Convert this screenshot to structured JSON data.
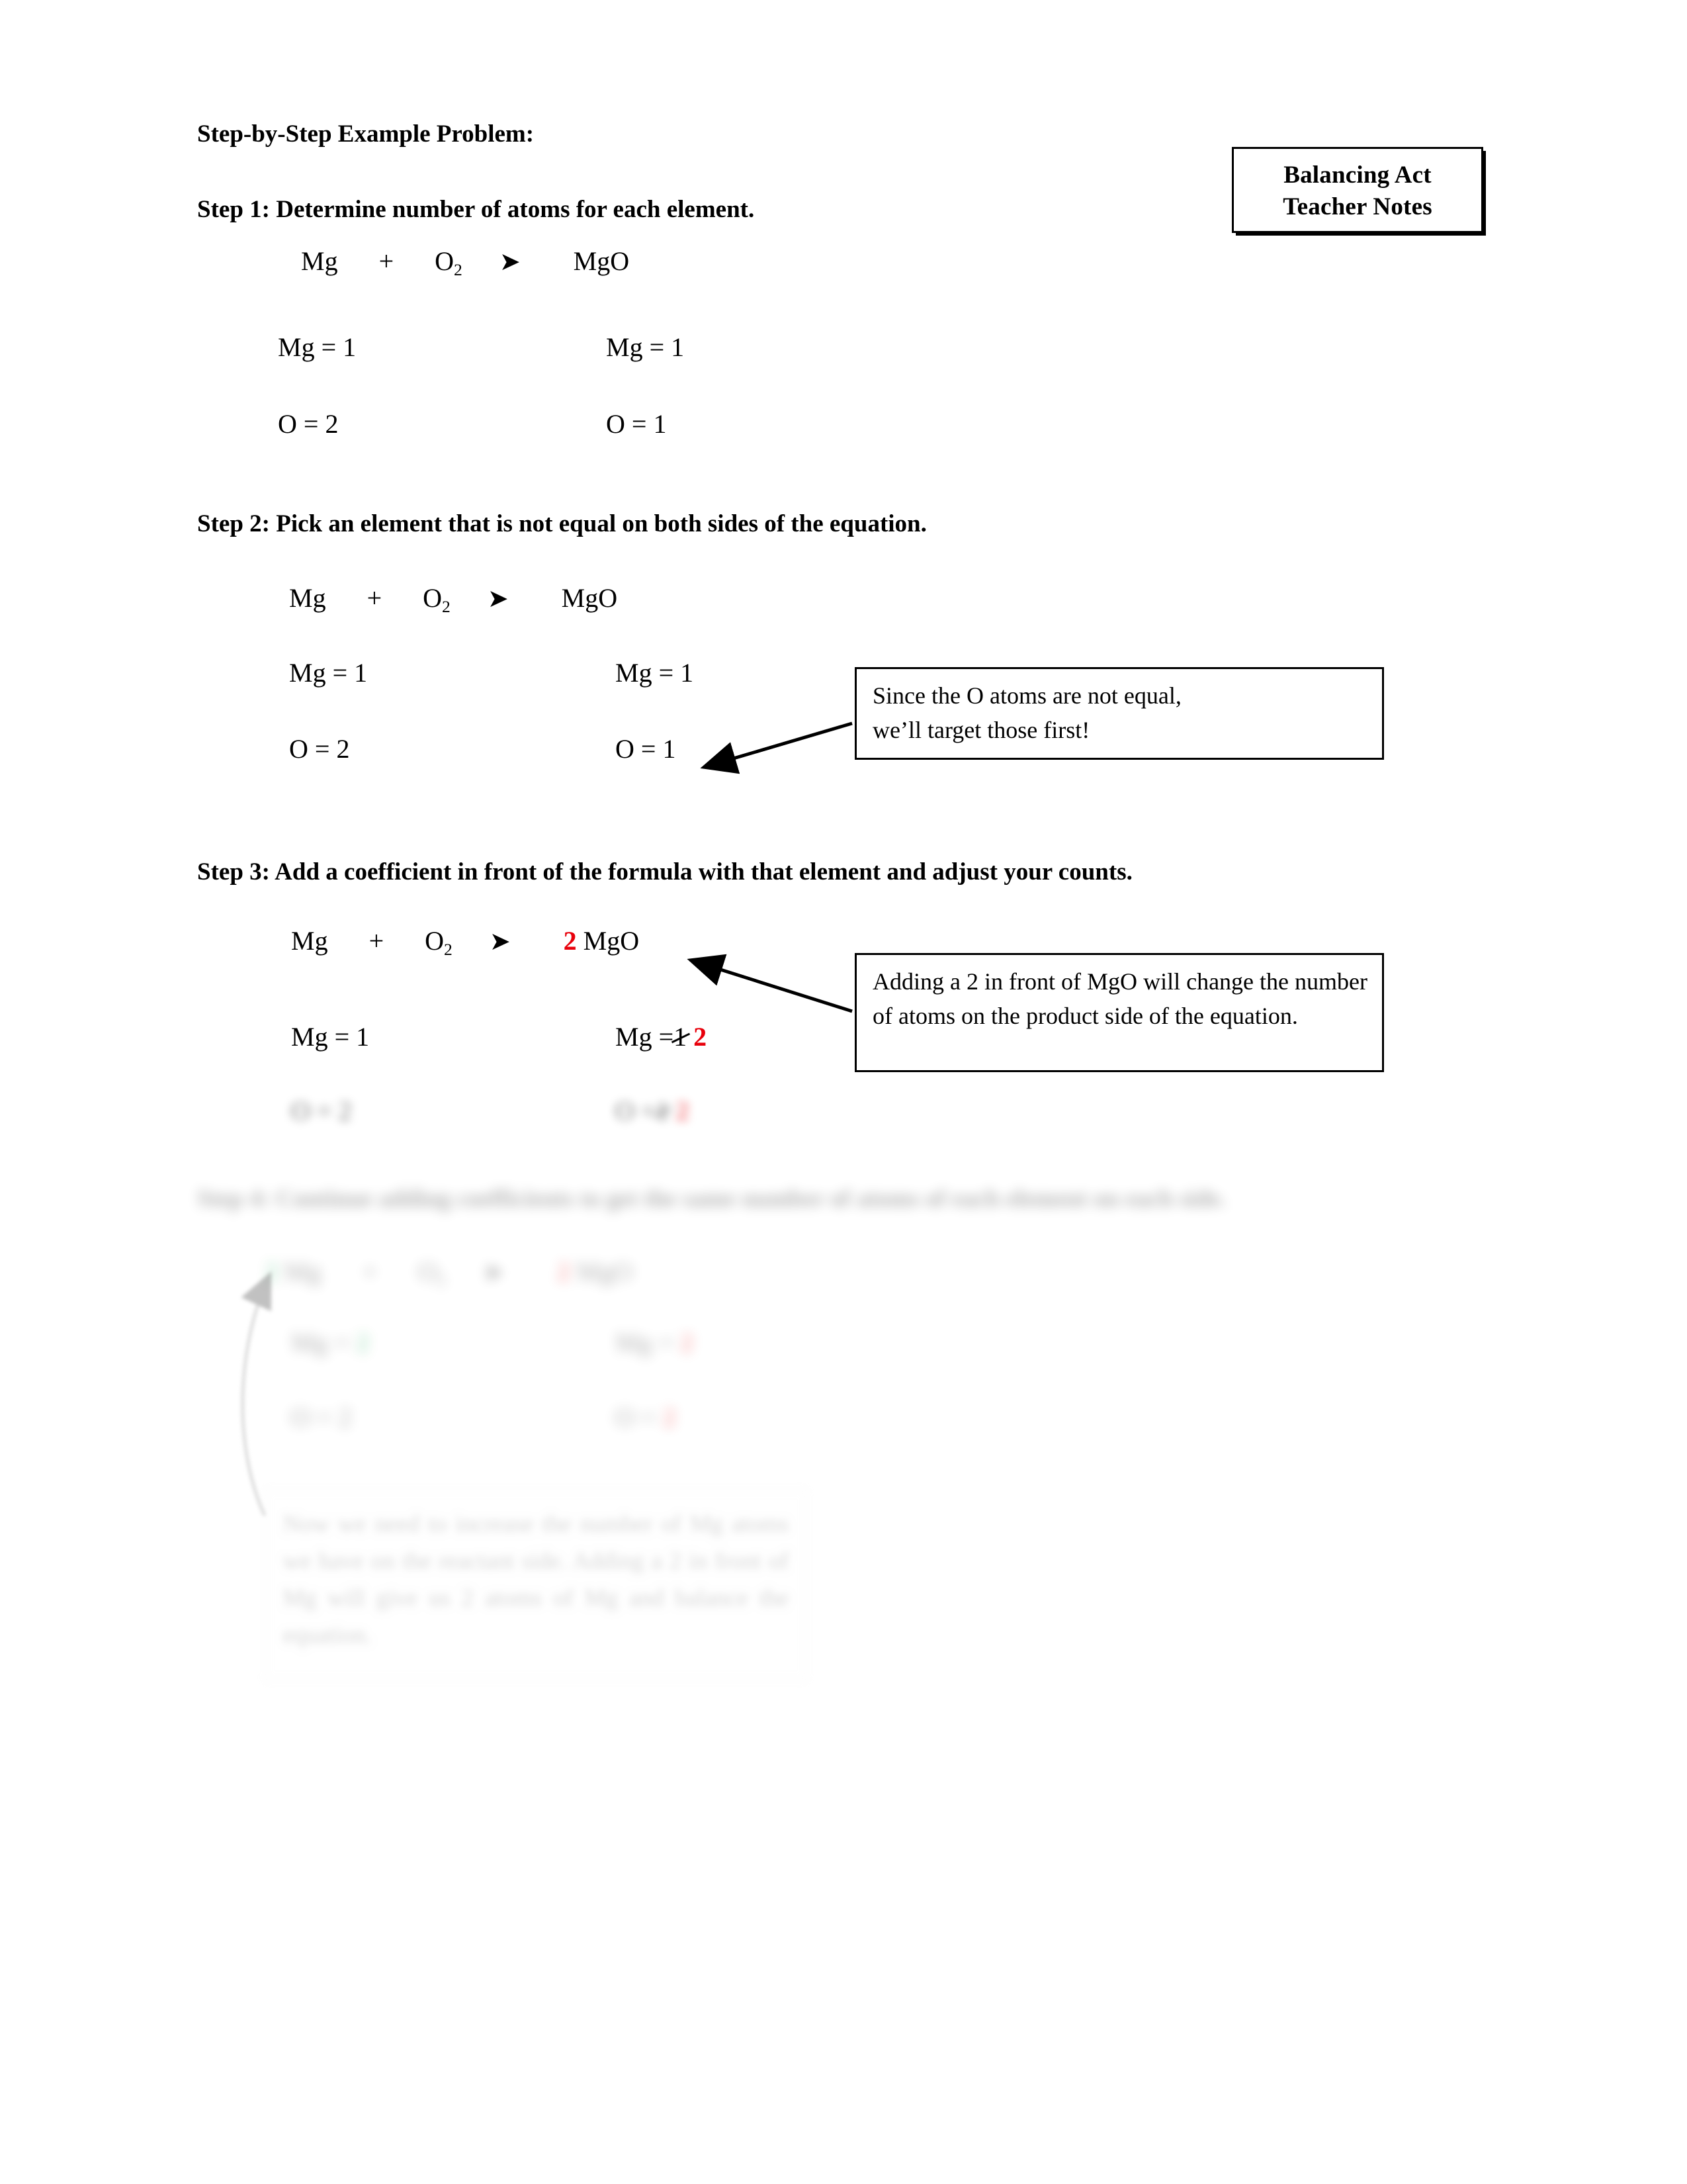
{
  "document": {
    "title": "Step-by-Step Example Problem:",
    "note_box": {
      "line1": "Balancing Act",
      "line2": "Teacher Notes"
    }
  },
  "steps": [
    {
      "id": "step1",
      "heading": "Step 1:  Determine number of atoms for each element.",
      "equation": {
        "reactant_1": "Mg",
        "plus": "+",
        "reactant_2_symbol": "O",
        "reactant_2_sub": "2",
        "arrow": "right-arrow-icon",
        "product_coefficient": "",
        "product": "MgO"
      },
      "counts_left": [
        "Mg = 1",
        "O = 2"
      ],
      "counts_right": [
        "Mg = 1",
        "O = 1"
      ]
    },
    {
      "id": "step2",
      "heading": "Step 2: Pick an element that is not equal on both sides of the equation.",
      "equation": {
        "reactant_1": "Mg",
        "plus": "+",
        "reactant_2_symbol": "O",
        "reactant_2_sub": "2",
        "arrow": "right-arrow-icon",
        "product_coefficient": "",
        "product": "MgO"
      },
      "counts_left": [
        "Mg = 1",
        "O = 2"
      ],
      "counts_right": [
        "Mg = 1",
        "O = 1"
      ],
      "callout": {
        "line1": "Since the O atoms are not equal,",
        "line2": "we’ll target those first!"
      }
    },
    {
      "id": "step3",
      "heading": "Step 3: Add a coefficient in front of the formula with that element and adjust your counts.",
      "equation": {
        "reactant_1": "Mg",
        "plus": "+",
        "reactant_2_symbol": "O",
        "reactant_2_sub": "2",
        "arrow": "right-arrow-icon",
        "product_coefficient": "2",
        "product": "MgO"
      },
      "counts_left": [
        "Mg = 1",
        "O = 2"
      ],
      "counts_right_mg": {
        "label": "Mg =",
        "struck_value": "1",
        "new_value": "2"
      },
      "counts_right_o": {
        "label": "O =",
        "struck_value": "1",
        "new_value": "2"
      },
      "callout": "Adding a 2 in front of MgO will change the number of atoms on the product side of the equation."
    },
    {
      "id": "step4",
      "heading": "Step 4: Continue adding coefficients to get the same number of atoms of each element on each side.",
      "equation": {
        "reactant_coefficient": "2",
        "reactant_1": "Mg",
        "plus": "+",
        "reactant_2_symbol": "O",
        "reactant_2_sub": "2",
        "arrow": "right-arrow-icon",
        "product_coefficient": "2",
        "product": "MgO"
      },
      "counts_left_mg": {
        "label": "Mg =",
        "new_value": "2"
      },
      "counts_left_o": {
        "label": "O = 2"
      },
      "counts_right_mg": {
        "label": "Mg =",
        "new_value": "2"
      },
      "counts_right_o": {
        "label": "O =",
        "new_value": "2"
      },
      "callout": "Now we need to increase the number of Mg atoms we have on the reactant side.  Adding a 2 in front of Mg will give us 2 atoms of Mg and balance the equation."
    }
  ],
  "colors": {
    "highlight_red": "#e8000b",
    "highlight_green": "#00a44a",
    "ink": "#000000",
    "page": "#ffffff"
  }
}
